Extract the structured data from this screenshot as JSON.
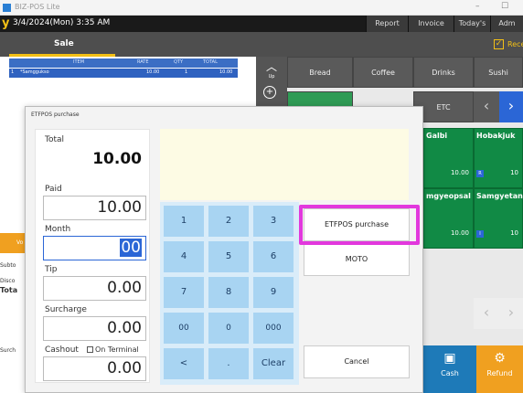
{
  "window": {
    "title": "BIZ-POS Lite"
  },
  "header": {
    "logo": "y",
    "datetime": "3/4/2024(Mon) 3:35 AM",
    "buttons": [
      "Report",
      "Invoice",
      "Today's",
      "Adm"
    ]
  },
  "sale_tab": {
    "label": "Sale",
    "receipt_label": "Rece"
  },
  "order_table": {
    "columns": [
      "ITEM",
      "RATE",
      "QTY",
      "TOTAL"
    ],
    "rows": [
      {
        "no": "1",
        "item": "*Samggukso",
        "rate": "10.00",
        "qty": "1",
        "total": "10.00"
      }
    ]
  },
  "middle": {
    "up_label": "Up"
  },
  "categories": [
    "Bread",
    "Coffee",
    "Drinks",
    "Sushi",
    "ETC"
  ],
  "products": [
    {
      "name": "Galbi",
      "price": "10.00",
      "tag": ""
    },
    {
      "name": "Hobakjuk",
      "price": "10",
      "tag": "R"
    },
    {
      "name": "mgyeopsal",
      "price": "10.00",
      "tag": ""
    },
    {
      "name": "Samgyetang",
      "price": "10",
      "tag": "I"
    }
  ],
  "actions": {
    "cash": "Cash",
    "refund": "Refund"
  },
  "side_fragments": {
    "vo": "Vo",
    "subtotal": "Subto",
    "discount": "Disco",
    "total": "Tota",
    "surcharge": "Surch"
  },
  "modal": {
    "title": "ETFPOS purchase",
    "total_label": "Total",
    "total_value": "10.00",
    "paid_label": "Paid",
    "paid_value": "10.00",
    "month_label": "Month",
    "month_value": "00",
    "tip_label": "Tip",
    "tip_value": "0.00",
    "surcharge_label": "Surcharge",
    "surcharge_value": "0.00",
    "cashout_label": "Cashout",
    "on_terminal_label": "On Terminal",
    "cashout_value": "0.00",
    "keypad": [
      "1",
      "2",
      "3",
      "4",
      "5",
      "6",
      "7",
      "8",
      "9",
      "00",
      "0",
      "000",
      "<",
      ".",
      "Clear"
    ],
    "etfpos_button": "ETFPOS purchase",
    "moto_button": "MOTO",
    "cancel_button": "Cancel"
  },
  "colors": {
    "accent": "#f3c016",
    "product_green": "#118a45",
    "highlight": "#e238dd",
    "keypad_key": "#a8d4f2"
  }
}
